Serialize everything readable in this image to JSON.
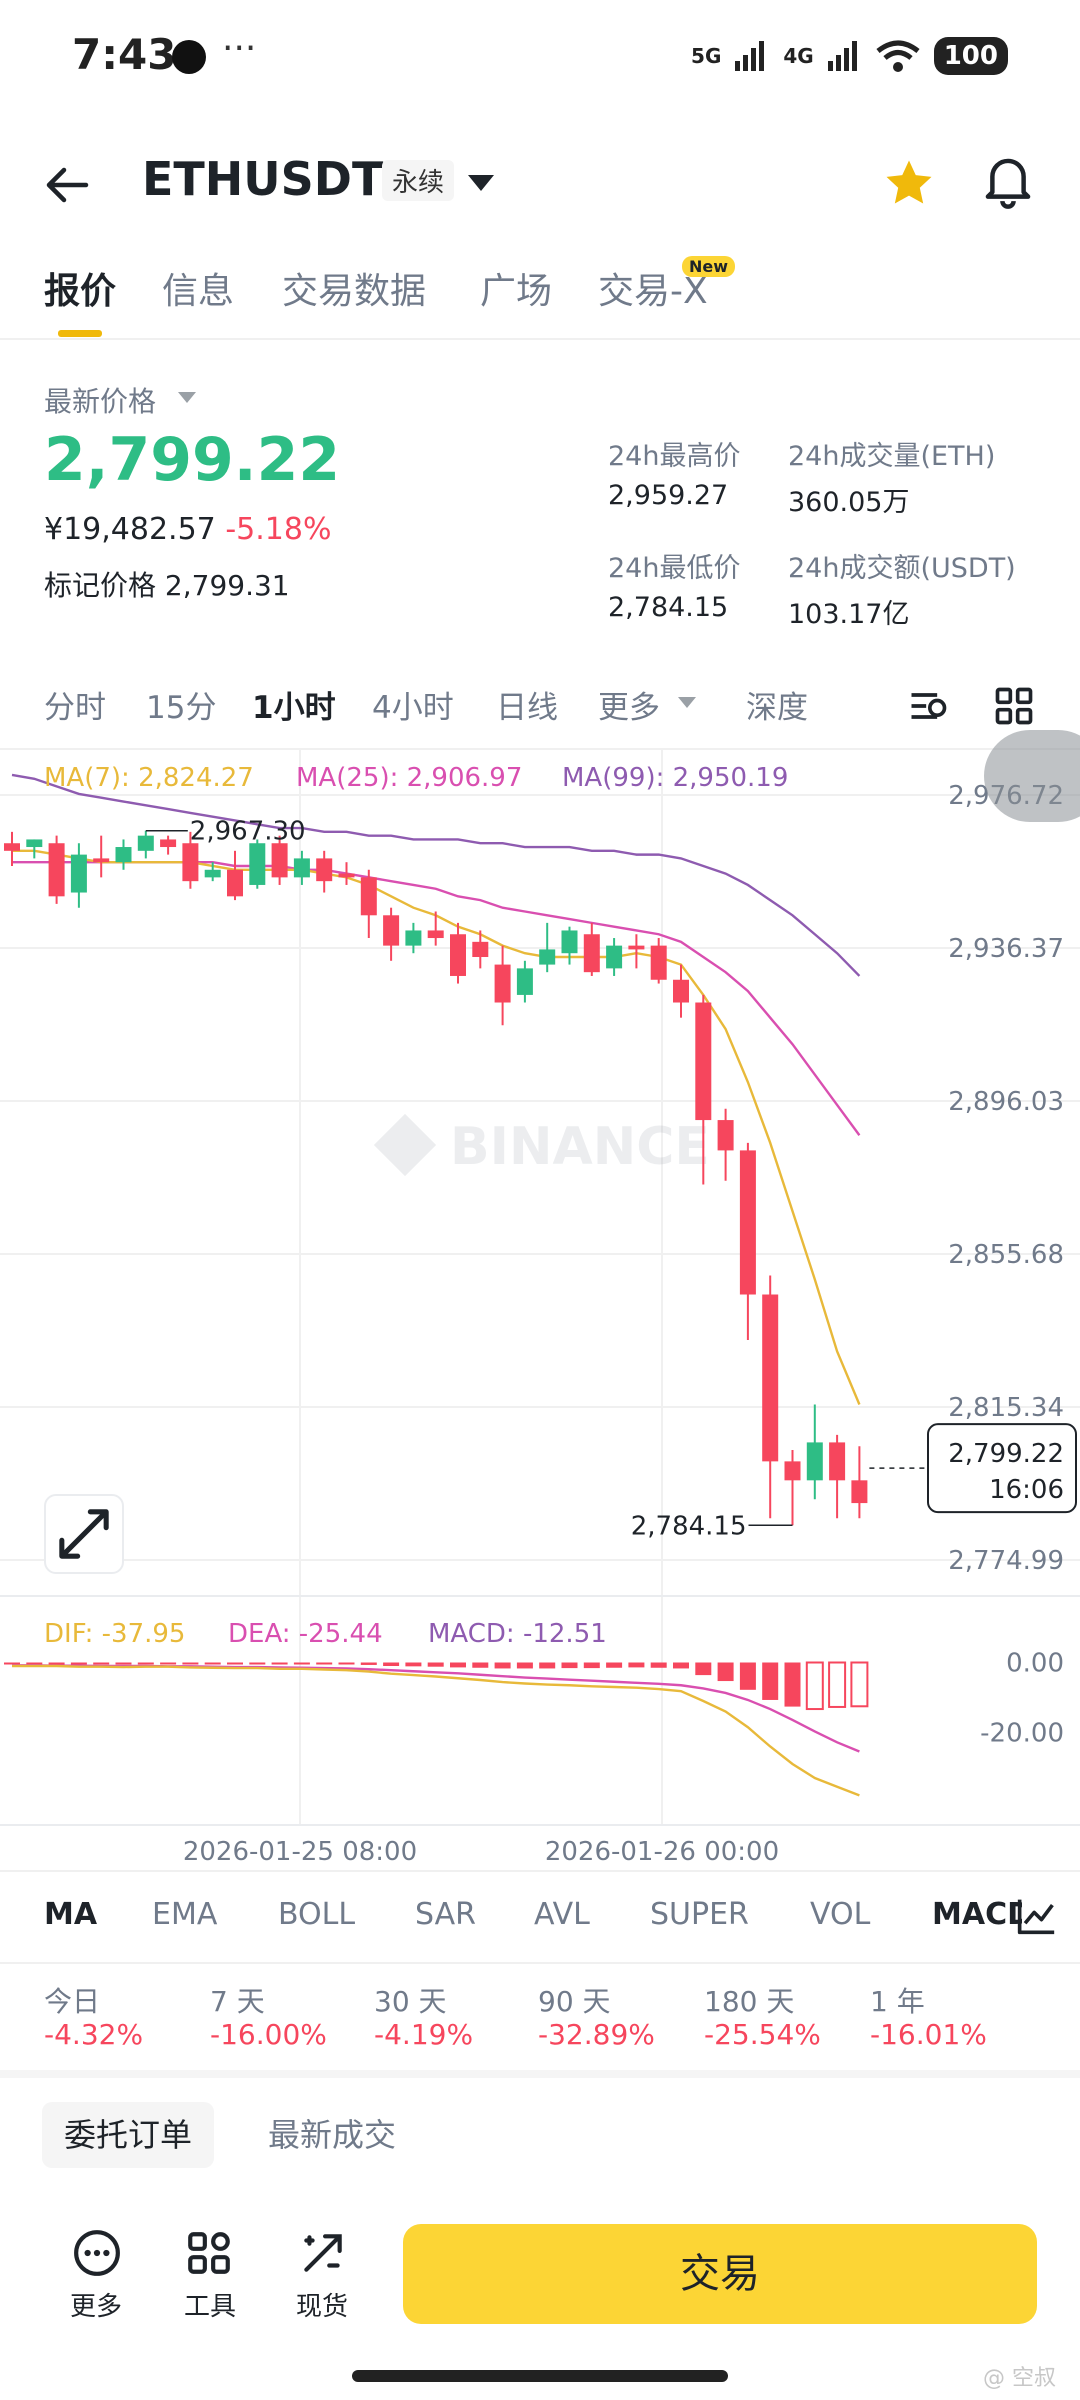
{
  "status_bar": {
    "time": "7:43",
    "dots": "···",
    "net1": "5G",
    "net2": "4G",
    "battery": "100"
  },
  "header": {
    "symbol": "ETHUSDT",
    "contract_type": "永续"
  },
  "tabs": [
    {
      "label": "报价"
    },
    {
      "label": "信息"
    },
    {
      "label": "交易数据"
    },
    {
      "label": "广场"
    },
    {
      "label": "交易-X"
    }
  ],
  "new_badge": "New",
  "price_panel": {
    "latest_label": "最新价格",
    "last_price": "2,799.22",
    "cny_price": "¥19,482.57",
    "change_pct": "-5.18%",
    "mark_label": "标记价格",
    "mark_price": "2,799.31",
    "high_label": "24h最高价",
    "high_value": "2,959.27",
    "low_label": "24h最低价",
    "low_value": "2,784.15",
    "vol_eth_label": "24h成交量(ETH)",
    "vol_eth_value": "360.05万",
    "vol_usdt_label": "24h成交额(USDT)",
    "vol_usdt_value": "103.17亿"
  },
  "timeframes": [
    "分时",
    "15分",
    "1小时",
    "4小时",
    "日线",
    "更多",
    "深度"
  ],
  "active_timeframe": "1小时",
  "ma_legend": {
    "ma7": "MA(7): 2,824.27",
    "ma25": "MA(25): 2,906.97",
    "ma99": "MA(99): 2,950.19"
  },
  "macd_legend": {
    "dif": "DIF: -37.95",
    "dea": "DEA: -25.44",
    "macd": "MACD: -12.51"
  },
  "watermark": "BINANCE",
  "colors": {
    "up": "#2ebd85",
    "down": "#f6465d",
    "ma7": "#e8b93a",
    "ma25": "#d94fb0",
    "ma99": "#8e5bb0",
    "accent": "#fcd535"
  },
  "chart_data": {
    "type": "candlestick",
    "timeframe": "1小时",
    "ylim": [
      2774.99,
      2976.72
    ],
    "y_ticks": [
      "2,976.72",
      "2,936.37",
      "2,896.03",
      "2,855.68",
      "2,815.34",
      "2,774.99"
    ],
    "x_ticks": [
      "2026-01-25 08:00",
      "2026-01-26 00:00"
    ],
    "high_marker": "2,967.30",
    "low_marker": "2,784.15",
    "current_price": "2,799.22",
    "countdown": "16:06",
    "candles": [
      {
        "o": 2964,
        "h": 2967,
        "c": 2962,
        "l": 2958
      },
      {
        "o": 2963,
        "h": 2965,
        "c": 2965,
        "l": 2960
      },
      {
        "o": 2964,
        "h": 2966,
        "c": 2950,
        "l": 2948
      },
      {
        "o": 2951,
        "h": 2964,
        "c": 2961,
        "l": 2947
      },
      {
        "o": 2960,
        "h": 2966,
        "c": 2959,
        "l": 2955
      },
      {
        "o": 2959,
        "h": 2965,
        "c": 2963,
        "l": 2957
      },
      {
        "o": 2962,
        "h": 2967.3,
        "c": 2966,
        "l": 2960
      },
      {
        "o": 2965,
        "h": 2966,
        "c": 2963,
        "l": 2961
      },
      {
        "o": 2964,
        "h": 2967,
        "c": 2954,
        "l": 2952
      },
      {
        "o": 2955,
        "h": 2959,
        "c": 2957,
        "l": 2954
      },
      {
        "o": 2957,
        "h": 2962,
        "c": 2950,
        "l": 2949
      },
      {
        "o": 2953,
        "h": 2965,
        "c": 2964,
        "l": 2952
      },
      {
        "o": 2964,
        "h": 2966,
        "c": 2955,
        "l": 2953
      },
      {
        "o": 2955,
        "h": 2962,
        "c": 2960,
        "l": 2953
      },
      {
        "o": 2960,
        "h": 2962,
        "c": 2954,
        "l": 2951
      },
      {
        "o": 2956,
        "h": 2959,
        "c": 2955,
        "l": 2953
      },
      {
        "o": 2955,
        "h": 2957,
        "c": 2945,
        "l": 2939
      },
      {
        "o": 2945,
        "h": 2947,
        "c": 2937,
        "l": 2933
      },
      {
        "o": 2937,
        "h": 2943,
        "c": 2941,
        "l": 2935
      },
      {
        "o": 2941,
        "h": 2946,
        "c": 2939,
        "l": 2937
      },
      {
        "o": 2940,
        "h": 2943,
        "c": 2929,
        "l": 2927
      },
      {
        "o": 2938,
        "h": 2941,
        "c": 2934,
        "l": 2931
      },
      {
        "o": 2932,
        "h": 2937,
        "c": 2922,
        "l": 2916
      },
      {
        "o": 2924,
        "h": 2933,
        "c": 2931,
        "l": 2922
      },
      {
        "o": 2932,
        "h": 2943,
        "c": 2936,
        "l": 2930
      },
      {
        "o": 2935,
        "h": 2942,
        "c": 2941,
        "l": 2932
      },
      {
        "o": 2940,
        "h": 2943,
        "c": 2930,
        "l": 2929
      },
      {
        "o": 2931,
        "h": 2939,
        "c": 2937,
        "l": 2929
      },
      {
        "o": 2937,
        "h": 2940,
        "c": 2936,
        "l": 2931
      },
      {
        "o": 2937,
        "h": 2939,
        "c": 2928,
        "l": 2927
      },
      {
        "o": 2928,
        "h": 2932,
        "c": 2922,
        "l": 2918
      },
      {
        "o": 2922,
        "h": 2924,
        "c": 2891,
        "l": 2874
      },
      {
        "o": 2891,
        "h": 2894,
        "c": 2883,
        "l": 2875
      },
      {
        "o": 2883,
        "h": 2885,
        "c": 2845,
        "l": 2833
      },
      {
        "o": 2845,
        "h": 2850,
        "c": 2801,
        "l": 2786
      },
      {
        "o": 2801,
        "h": 2804,
        "c": 2796,
        "l": 2784.15
      },
      {
        "o": 2796,
        "h": 2816,
        "c": 2806,
        "l": 2791
      },
      {
        "o": 2806,
        "h": 2808,
        "c": 2796,
        "l": 2786
      },
      {
        "o": 2796,
        "h": 2805,
        "c": 2790,
        "l": 2786
      }
    ],
    "ma7": [
      2962,
      2962,
      2961,
      2960,
      2959,
      2959,
      2959,
      2959,
      2959,
      2958,
      2957,
      2957,
      2957,
      2957,
      2956,
      2955,
      2953,
      2950,
      2947,
      2945,
      2942,
      2940,
      2937,
      2935,
      2934,
      2934,
      2934,
      2934,
      2935,
      2934,
      2932,
      2924,
      2915,
      2901,
      2885,
      2867,
      2849,
      2830,
      2816
    ],
    "ma25": [
      2959,
      2959,
      2959,
      2959,
      2959,
      2959,
      2959,
      2959,
      2959,
      2959,
      2958,
      2958,
      2958,
      2957,
      2957,
      2956,
      2955,
      2954,
      2953,
      2952,
      2950,
      2949,
      2947,
      2946,
      2945,
      2944,
      2943,
      2942,
      2941,
      2940,
      2938,
      2934,
      2930,
      2925,
      2918,
      2911,
      2903,
      2895,
      2887
    ],
    "ma99": [
      2982,
      2981,
      2979,
      2977,
      2976,
      2975,
      2974,
      2973,
      2972,
      2971,
      2970,
      2969,
      2968,
      2968,
      2967,
      2967,
      2966,
      2966,
      2965,
      2965,
      2965,
      2964,
      2964,
      2963,
      2963,
      2963,
      2962,
      2962,
      2961,
      2961,
      2960,
      2958,
      2956,
      2953,
      2949,
      2945,
      2940,
      2935,
      2929
    ],
    "macd_ylim": [
      -45,
      5
    ],
    "macd_ticks": [
      "0.00",
      "-20.00"
    ],
    "dif": [
      -1,
      -1,
      -1,
      -1.2,
      -1.2,
      -1.3,
      -1.2,
      -1.2,
      -1.4,
      -1.5,
      -1.6,
      -1.6,
      -1.8,
      -1.8,
      -2,
      -2.2,
      -2.6,
      -3.2,
      -3.6,
      -4,
      -4.5,
      -5,
      -5.6,
      -6,
      -6.3,
      -6.5,
      -6.8,
      -7,
      -7.2,
      -7.6,
      -8.2,
      -11,
      -14,
      -18.5,
      -24,
      -29,
      -33,
      -35.5,
      -37.95
    ],
    "dea": [
      -0.8,
      -0.8,
      -0.9,
      -0.9,
      -1,
      -1,
      -1,
      -1.1,
      -1.1,
      -1.2,
      -1.3,
      -1.3,
      -1.4,
      -1.5,
      -1.6,
      -1.7,
      -1.9,
      -2.2,
      -2.5,
      -2.8,
      -3.1,
      -3.5,
      -3.9,
      -4.3,
      -4.6,
      -4.9,
      -5.2,
      -5.5,
      -5.8,
      -6.1,
      -6.5,
      -7.4,
      -8.7,
      -10.7,
      -13.3,
      -16.4,
      -19.7,
      -22.8,
      -25.44
    ],
    "macd_hist": [
      -0.2,
      -0.2,
      -0.1,
      -0.3,
      -0.2,
      -0.3,
      -0.2,
      -0.1,
      -0.3,
      -0.3,
      -0.3,
      -0.3,
      -0.4,
      -0.3,
      -0.4,
      -0.5,
      -0.7,
      -1,
      -1.1,
      -1.2,
      -1.4,
      -1.5,
      -1.7,
      -1.7,
      -1.7,
      -1.6,
      -1.6,
      -1.5,
      -1.4,
      -1.5,
      -1.7,
      -3.6,
      -5.3,
      -7.8,
      -10.7,
      -12.6,
      -13.3,
      -12.7,
      -12.51
    ]
  },
  "indicators": [
    "MA",
    "EMA",
    "BOLL",
    "SAR",
    "AVL",
    "SUPER",
    "VOL",
    "MACD"
  ],
  "performance": [
    {
      "label": "今日",
      "value": "-4.32%"
    },
    {
      "label": "7 天",
      "value": "-16.00%"
    },
    {
      "label": "30 天",
      "value": "-4.19%"
    },
    {
      "label": "90 天",
      "value": "-32.89%"
    },
    {
      "label": "180 天",
      "value": "-25.54%"
    },
    {
      "label": "1 年",
      "value": "-16.01%"
    }
  ],
  "order_tabs": {
    "open_orders": "委托订单",
    "latest_trades": "最新成交"
  },
  "bottom_bar": {
    "more": "更多",
    "tools": "工具",
    "spot": "现货",
    "trade": "交易"
  },
  "credit": "@ 空叔"
}
